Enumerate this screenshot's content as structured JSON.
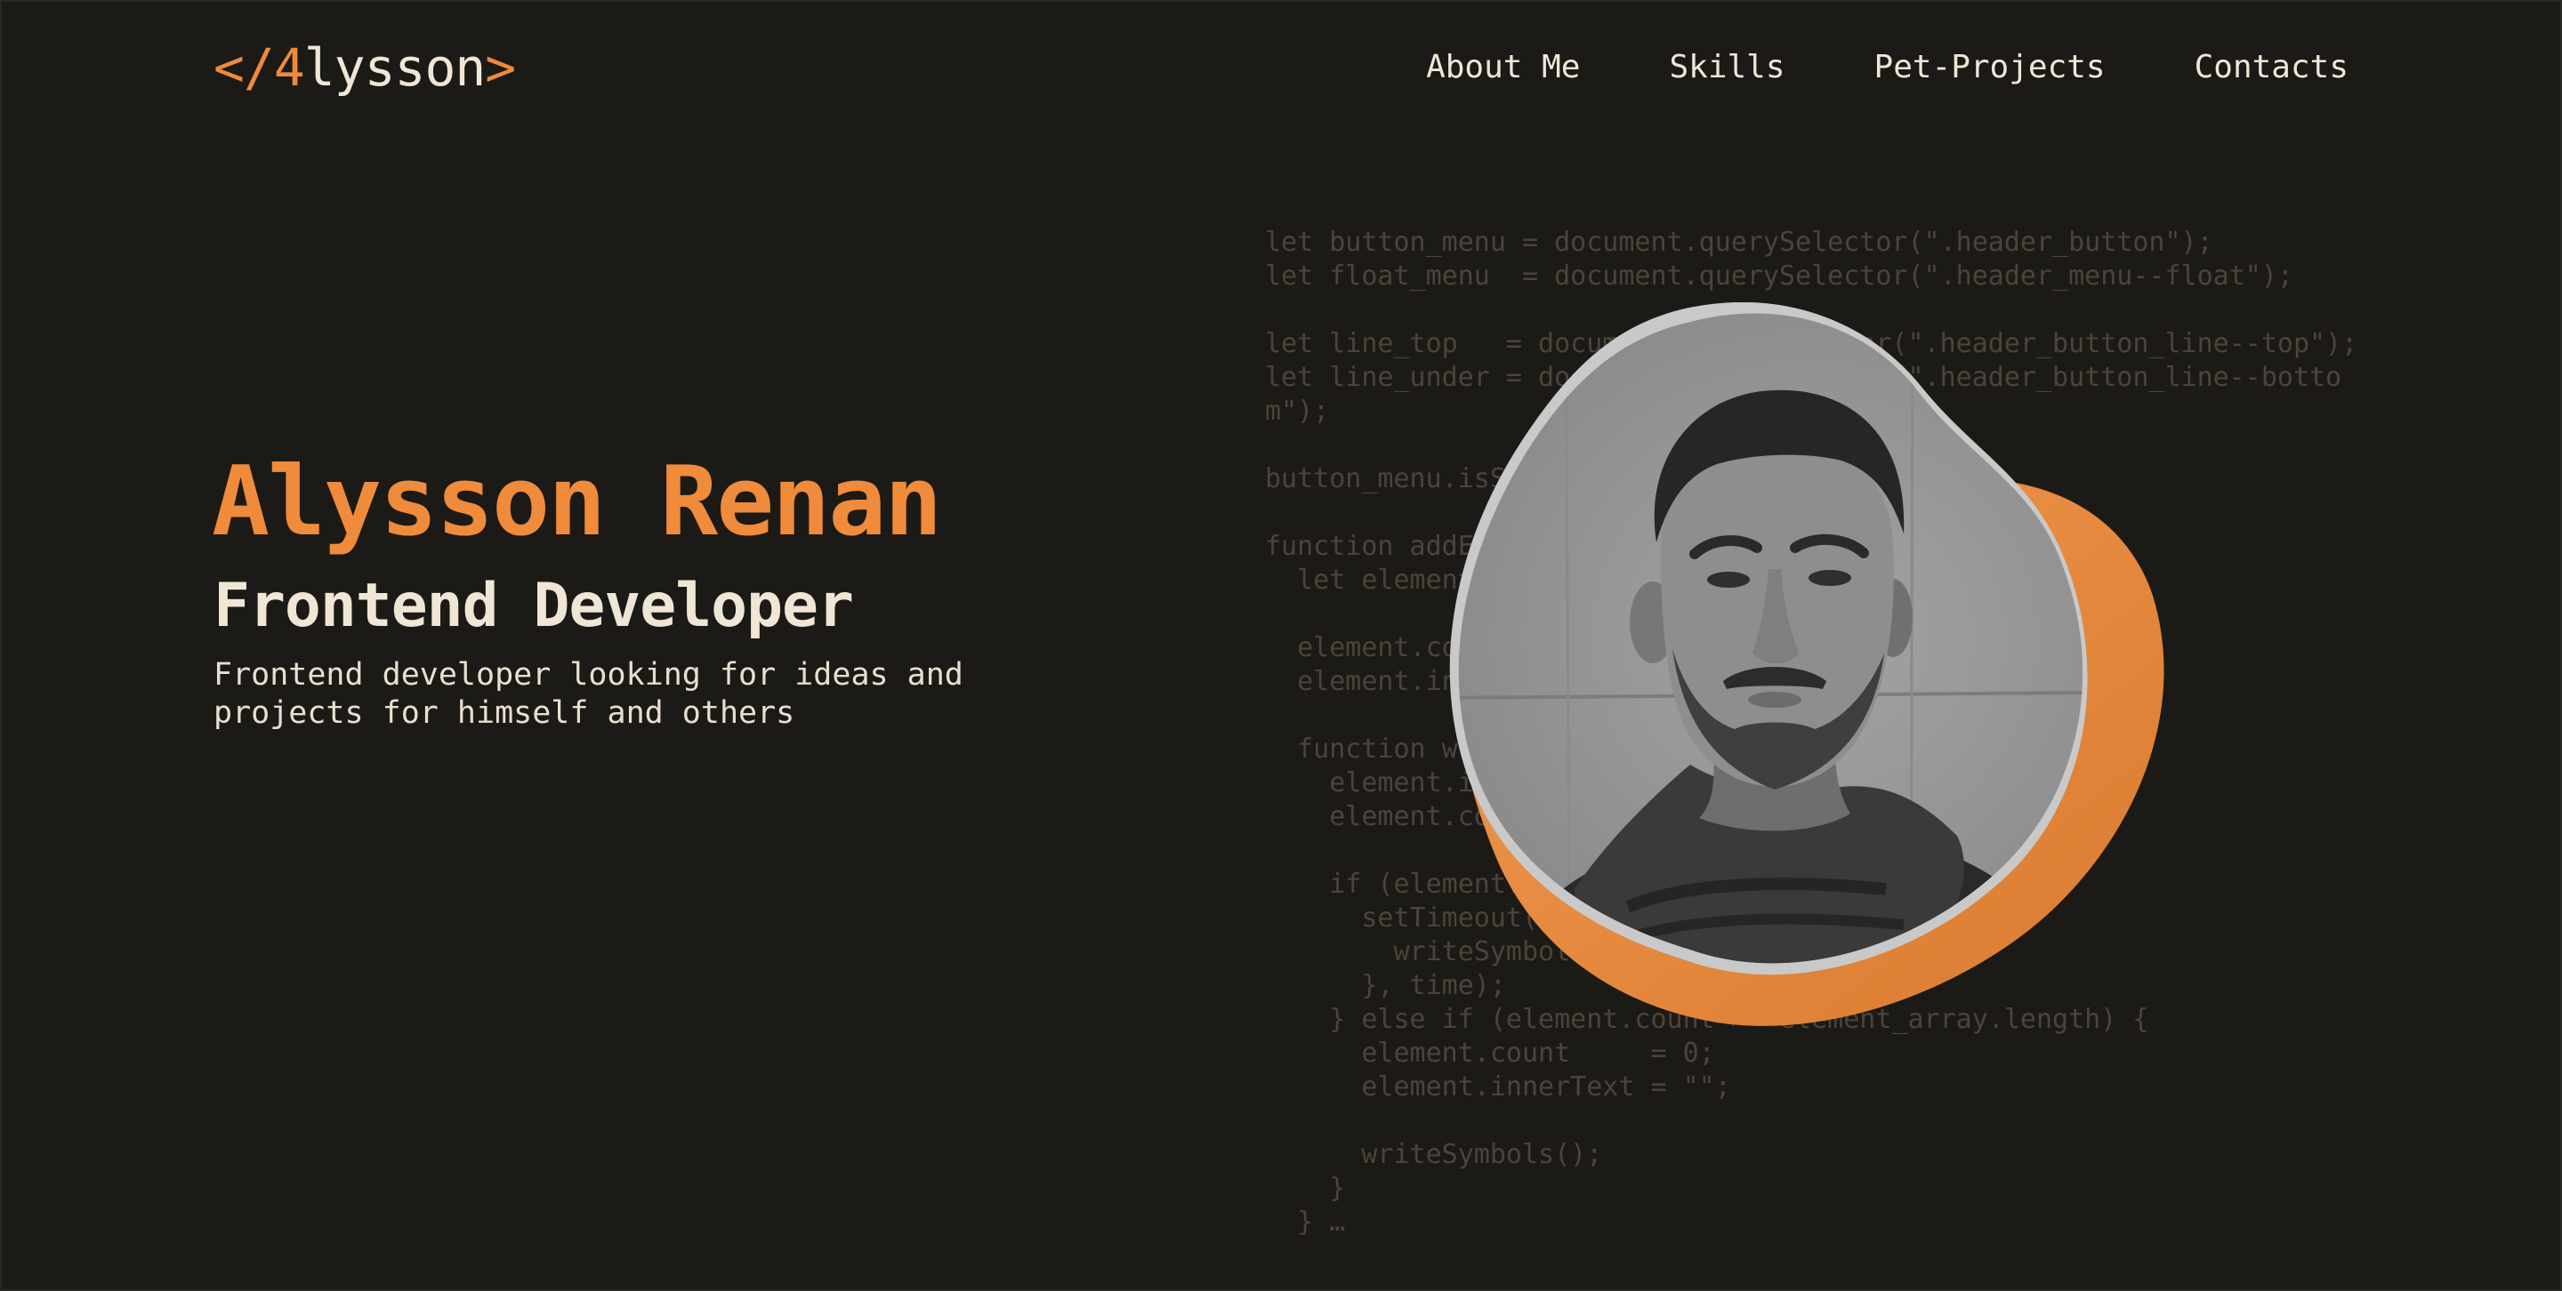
{
  "header": {
    "logo_prefix": "</4",
    "logo_name": "lysson",
    "logo_suffix": ">",
    "nav": [
      "About Me",
      "Skills",
      "Pet-Projects",
      "Contacts"
    ]
  },
  "hero": {
    "name": "Alysson Renan",
    "role": "Frontend Developer",
    "description": "Frontend developer looking for ideas and projects for himself and others"
  },
  "code_lines": [
    "let button_menu = document.querySelector(\".header_button\");",
    "let float_menu  = document.querySelector(\".header_menu--float\");",
    "",
    "let line_top   = document.querySelector(\".header_button_line--top\");",
    "let line_under = document.querySelector(\".header_button_line--bottom\");",
    "",
    "button_menu.isSelected = false;",
    "",
    "function addEffect(selector, time) {",
    "  let element = document.querySelector(selector);",
    "",
    "  element.count     = 0;",
    "  element.innerText = \"\";",
    "",
    "  function writeSymbols() {",
    "    element.innerText += element_array[element.count];",
    "    element.count++;",
    "",
    "    if (element.count < element_array.length) {",
    "      setTimeout(() => {",
    "        writeSymbols();",
    "      }, time);",
    "    } else if (element.count >= element_array.length) {",
    "      element.count     = 0;",
    "      element.innerText = \"\";",
    "",
    "      writeSymbols();",
    "    }",
    "  } …"
  ],
  "colors": {
    "background": "#1c1a17",
    "accent": "#ef8b3b",
    "text": "#efe6d6",
    "code": "#4b4438"
  }
}
